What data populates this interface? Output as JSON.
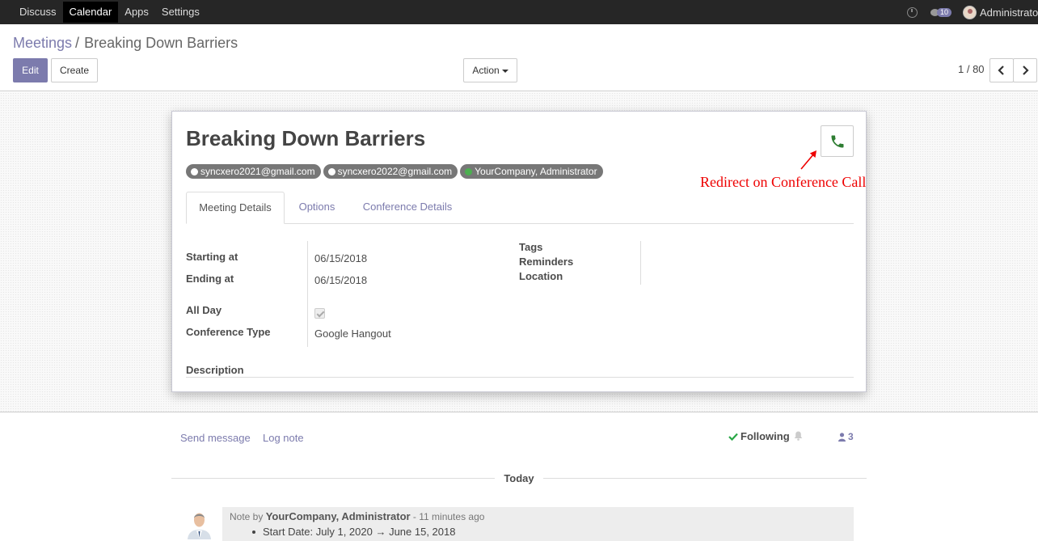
{
  "navbar": {
    "menu": [
      "Discuss",
      "Calendar",
      "Apps",
      "Settings"
    ],
    "active": "Calendar",
    "chat_count": "10",
    "user": "Administrator"
  },
  "breadcrumb": {
    "parent": "Meetings",
    "separator": "/",
    "current": "Breaking Down Barriers"
  },
  "buttons": {
    "edit": "Edit",
    "create": "Create",
    "action": "Action"
  },
  "pager": {
    "text": "1 / 80"
  },
  "record": {
    "title": "Breaking Down Barriers",
    "attendees": [
      {
        "label": "syncxero2021@gmail.com",
        "status": "white"
      },
      {
        "label": "syncxero2022@gmail.com",
        "status": "white"
      },
      {
        "label": "YourCompany, Administrator",
        "status": "green"
      }
    ],
    "tabs": [
      "Meeting Details",
      "Options",
      "Conference Details"
    ],
    "fields": {
      "starting_at_label": "Starting at",
      "starting_at": "06/15/2018",
      "ending_at_label": "Ending at",
      "ending_at": "06/15/2018",
      "all_day_label": "All Day",
      "all_day": true,
      "conference_type_label": "Conference Type",
      "conference_type": "Google Hangout",
      "tags_label": "Tags",
      "reminders_label": "Reminders",
      "location_label": "Location",
      "description_label": "Description"
    }
  },
  "annotation": {
    "text": "Redirect on Conference Call",
    "color": "#e00000"
  },
  "chatter": {
    "send_message": "Send message",
    "log_note": "Log note",
    "following": "Following",
    "followers_count": "3",
    "day_label": "Today",
    "message": {
      "prefix": "Note by ",
      "author": "YourCompany, Administrator",
      "time": " - 11 minutes ago",
      "item": "Start Date: July 1, 2020 → June 15, 2018"
    }
  },
  "colors": {
    "brand": "#7c7bad",
    "navbar": "#262626",
    "phone_icon": "#2e7d32"
  }
}
